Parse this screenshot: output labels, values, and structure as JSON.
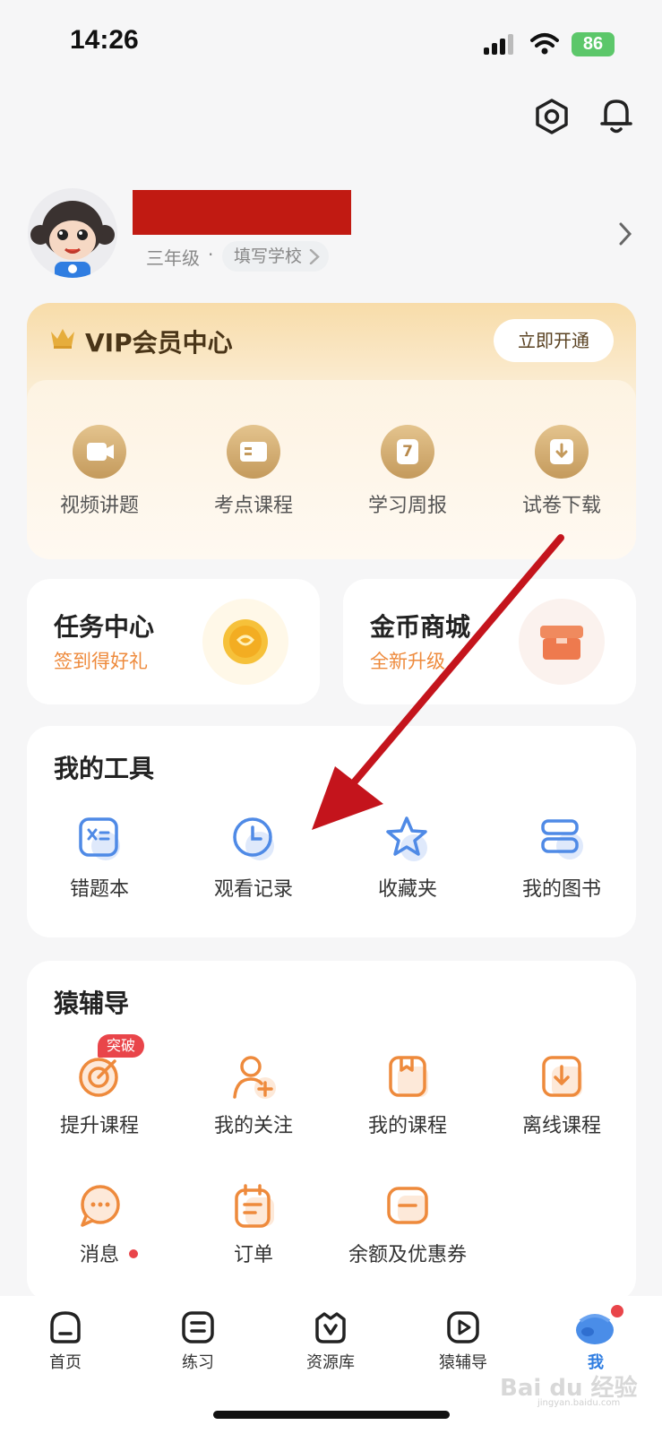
{
  "status_bar": {
    "time": "14:26",
    "battery": "86"
  },
  "profile": {
    "grade": "三年级",
    "separator": "·",
    "school_placeholder": "填写学校"
  },
  "vip": {
    "title": "VIP会员中心",
    "open_button": "立即开通",
    "items": [
      {
        "label": "视频讲题",
        "icon": "video-icon"
      },
      {
        "label": "考点课程",
        "icon": "course-icon"
      },
      {
        "label": "学习周报",
        "icon": "weekly-report-icon",
        "glyph": "7"
      },
      {
        "label": "试卷下载",
        "icon": "download-icon"
      }
    ]
  },
  "task_center": {
    "title": "任务中心",
    "subtitle": "签到得好礼",
    "icon": "gold-coin-icon"
  },
  "coin_mall": {
    "title": "金币商城",
    "subtitle": "全新升级",
    "icon": "shop-icon"
  },
  "my_tools": {
    "title": "我的工具",
    "items": [
      {
        "label": "错题本",
        "icon": "wrong-answer-book-icon"
      },
      {
        "label": "观看记录",
        "icon": "clock-icon"
      },
      {
        "label": "收藏夹",
        "icon": "star-icon"
      },
      {
        "label": "我的图书",
        "icon": "books-icon"
      }
    ]
  },
  "tutoring": {
    "title": "猿辅导",
    "badge": "突破",
    "items": [
      {
        "label": "提升课程",
        "icon": "target-icon"
      },
      {
        "label": "我的关注",
        "icon": "follow-user-icon"
      },
      {
        "label": "我的课程",
        "icon": "my-course-icon"
      },
      {
        "label": "离线课程",
        "icon": "offline-download-icon"
      },
      {
        "label": "消息",
        "icon": "message-icon"
      },
      {
        "label": "订单",
        "icon": "order-icon"
      },
      {
        "label": "余额及优惠券",
        "icon": "wallet-coupon-icon"
      }
    ]
  },
  "tab_bar": {
    "items": [
      {
        "label": "首页",
        "icon": "home-icon"
      },
      {
        "label": "练习",
        "icon": "practice-icon"
      },
      {
        "label": "资源库",
        "icon": "resource-icon"
      },
      {
        "label": "猿辅导",
        "icon": "play-icon"
      },
      {
        "label": "我",
        "icon": "me-icon"
      }
    ]
  },
  "watermark": {
    "text": "Bai du 经验",
    "sub": "jingyan.baidu.com"
  },
  "colors": {
    "accent_orange": "#ee8a3c",
    "tool_blue": "#4f8ae6",
    "vip_gold": "#c8a266",
    "redact_red": "#c11a12",
    "arrow_red": "#c4141c"
  }
}
